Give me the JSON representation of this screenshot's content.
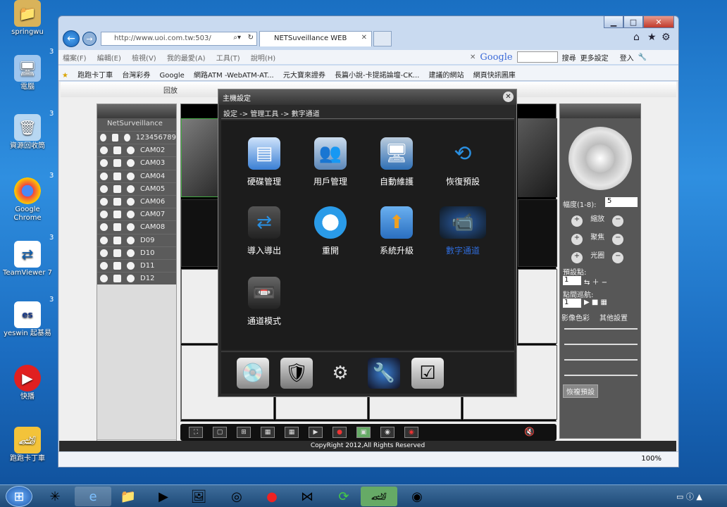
{
  "desktop": {
    "icons": [
      "springwu",
      "電腦",
      "資源回收筒",
      "Google Chrome",
      "TeamViewer 7",
      "yeswin 起基易",
      "快播",
      "跑跑卡丁車"
    ],
    "side_numbers": [
      "3",
      "3",
      "3",
      "3",
      "3"
    ]
  },
  "browser": {
    "url": "http://www.uoi.com.tw:503/",
    "tab_title": "NETSuveillance WEB",
    "menu": [
      "檔案(F)",
      "編輯(E)",
      "檢視(V)",
      "我的最愛(A)",
      "工具(T)",
      "說明(H)"
    ],
    "google_label": "Google",
    "search_label": "搜尋",
    "more_settings": "更多設定",
    "login": "登入",
    "favorites": [
      "跑跑卡丁車",
      "台灣彩券",
      "Google",
      "網路ATM -WebATM-AT...",
      "元大寶來證券",
      "長篇小說-卡提諾論壇-CK...",
      "建議的網站",
      "網頁快訊圖庫"
    ],
    "zoom": "100%"
  },
  "dvr": {
    "top_tab": "回放",
    "panel_title": "NetSurveillance",
    "channels": [
      "123456789",
      "CAM02",
      "CAM03",
      "CAM04",
      "CAM05",
      "CAM06",
      "CAM07",
      "CAM08",
      "D09",
      "D10",
      "D11",
      "D12"
    ],
    "copyright": "CopyRight 2012,All Rights Reserved",
    "ptz": {
      "step_label": "幅度(1-8):",
      "step_value": "5",
      "zoom": "縮放",
      "focus": "聚焦",
      "iris": "光圈",
      "preset": "預設點:",
      "preset_value": "1",
      "cruise": "點間巡航:",
      "cruise_value": "1",
      "tab_color": "影像色彩",
      "tab_other": "其他設置",
      "restore": "恢複預設"
    }
  },
  "dialog": {
    "title": "主機設定",
    "breadcrumb": "設定 -> 管理工具 -> 數字通道",
    "items": [
      {
        "label": "硬碟管理",
        "icon": "hdd-icon",
        "color": "#3a7fd4"
      },
      {
        "label": "用戶管理",
        "icon": "users-icon",
        "color": "#5aa0e8"
      },
      {
        "label": "自動維護",
        "icon": "monitor-icon",
        "color": "#2e6fb5"
      },
      {
        "label": "恢復預設",
        "icon": "refresh-icon",
        "color": "#2a8fe0"
      },
      {
        "label": "導入導出",
        "icon": "import-export-icon",
        "color": "#1f6fc8"
      },
      {
        "label": "重開",
        "icon": "power-icon",
        "color": "#2a9be8"
      },
      {
        "label": "系統升級",
        "icon": "upgrade-icon",
        "color": "#f0a020"
      },
      {
        "label": "數字通道",
        "icon": "camera-icon",
        "color": "#444"
      },
      {
        "label": "通道模式",
        "icon": "channel-mode-icon",
        "color": "#555"
      }
    ]
  }
}
